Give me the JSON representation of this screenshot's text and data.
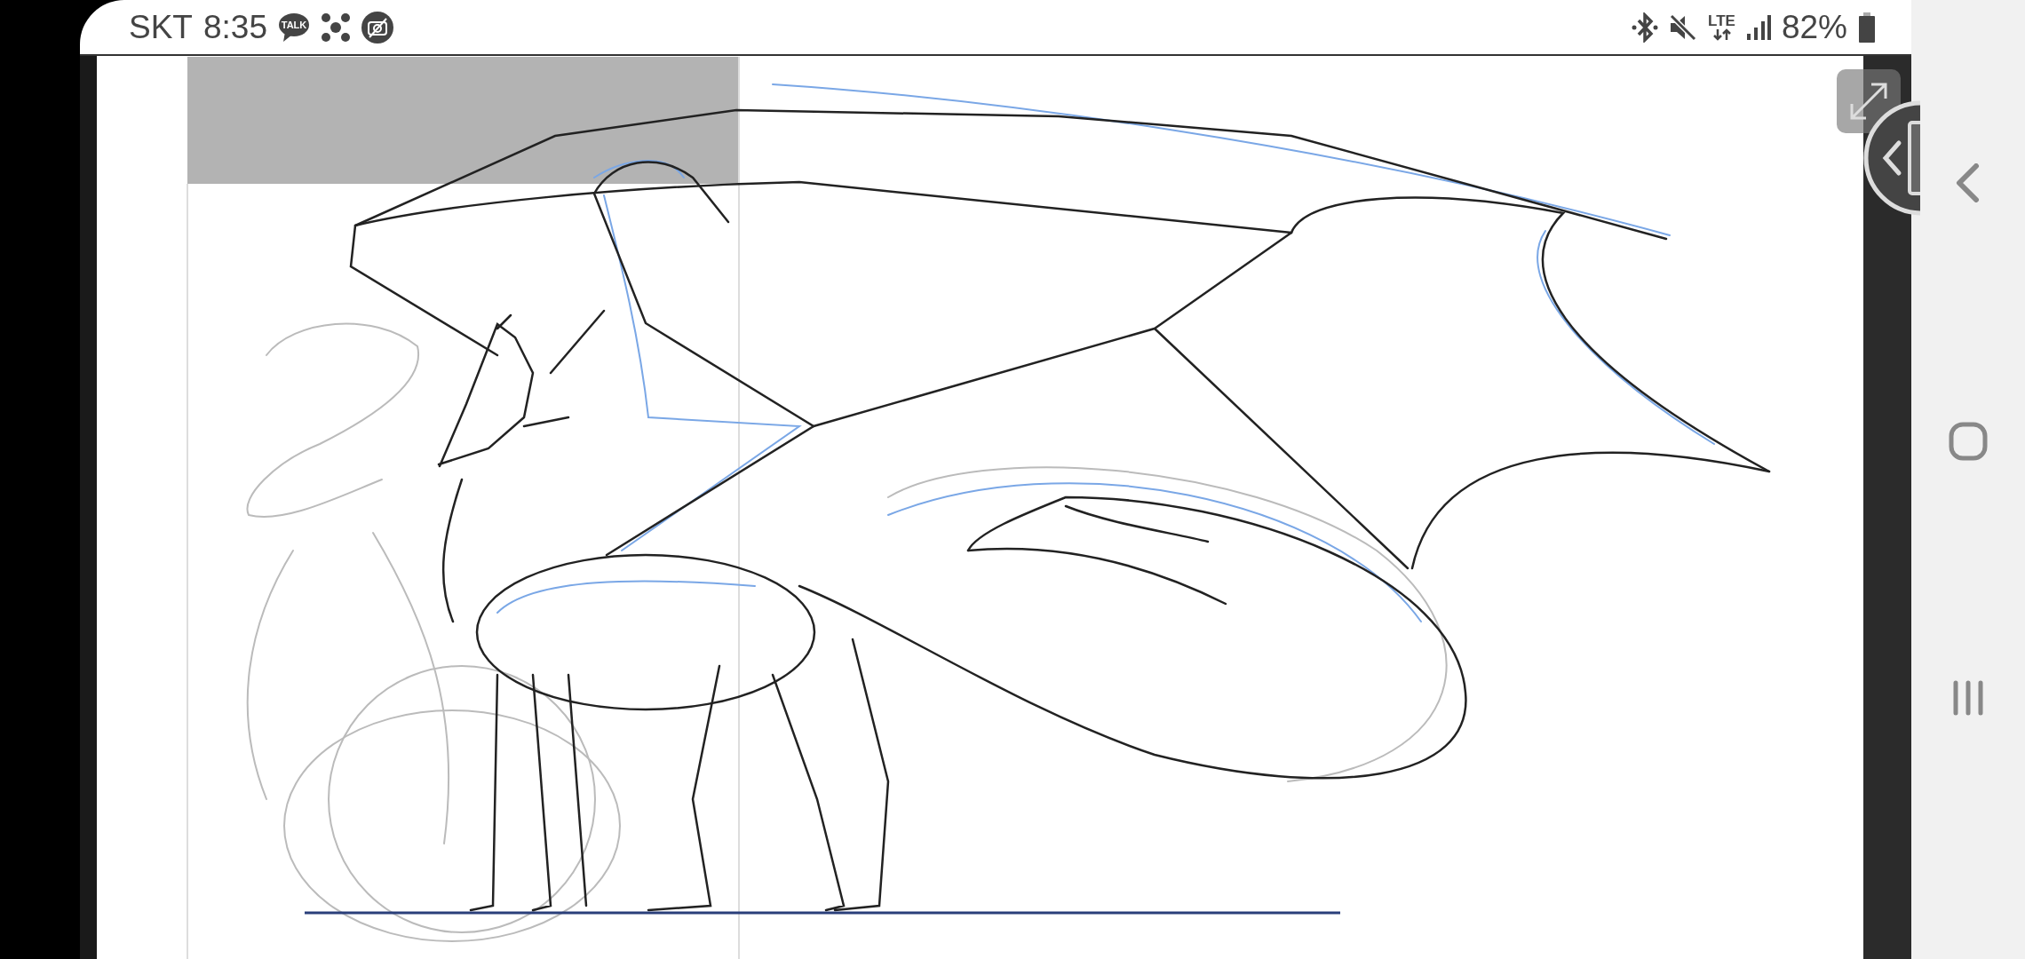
{
  "status_bar": {
    "carrier": "SKT",
    "time": "8:35",
    "chat_badge": "TALK",
    "network": "LTE",
    "battery": "82%"
  }
}
